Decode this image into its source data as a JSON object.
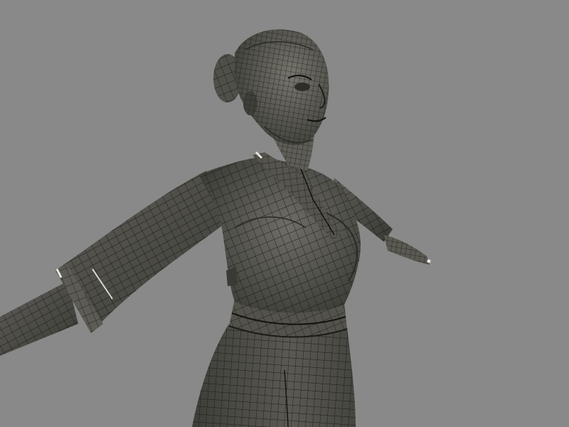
{
  "scene": {
    "subject": "",
    "render_mode": "shaded-wireframe",
    "colors": {
      "background": "#898989",
      "mesh_fill": "#4e4e48",
      "mesh_fill_light": "#6f6e66",
      "mesh_fill_dark": "#2f2f2b",
      "wire": "#14140f",
      "highlight": "#e8e8e2"
    }
  }
}
